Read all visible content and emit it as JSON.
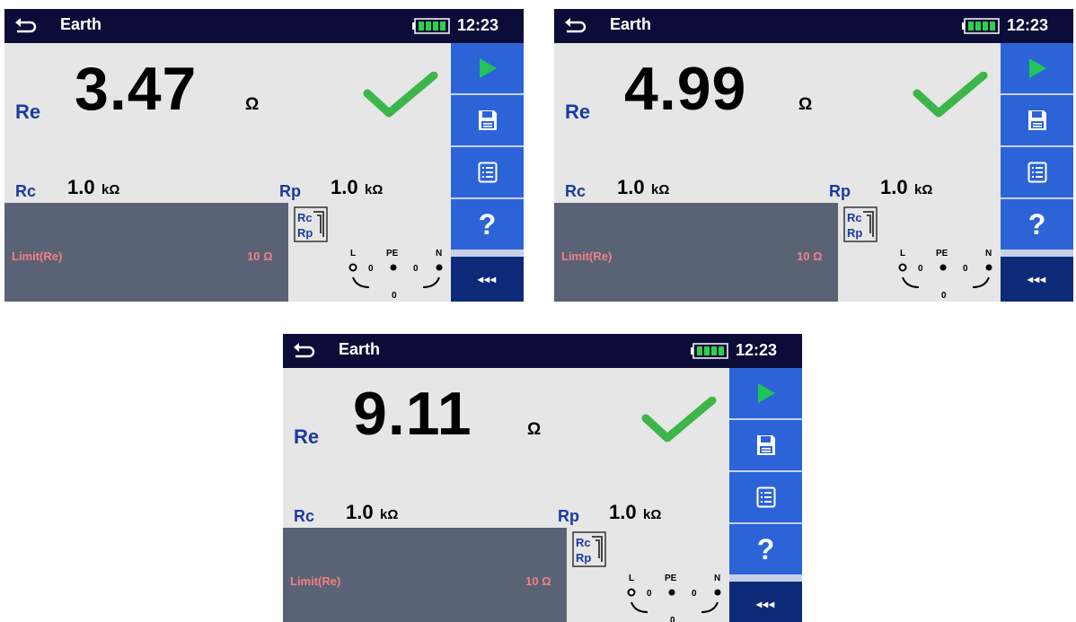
{
  "screens": [
    {
      "title": "Earth",
      "clock": "12:23",
      "re": {
        "label": "Re",
        "value": "3.47",
        "unit": "Ω"
      },
      "rc": {
        "label": "Rc",
        "value": "1.0",
        "unit": "kΩ"
      },
      "rp": {
        "label": "Rp",
        "value": "1.0",
        "unit": "kΩ"
      },
      "limit": {
        "label": "Limit(Re)",
        "value": "10 Ω"
      }
    },
    {
      "title": "Earth",
      "clock": "12:23",
      "re": {
        "label": "Re",
        "value": "4.99",
        "unit": "Ω"
      },
      "rc": {
        "label": "Rc",
        "value": "1.0",
        "unit": "kΩ"
      },
      "rp": {
        "label": "Rp",
        "value": "1.0",
        "unit": "kΩ"
      },
      "limit": {
        "label": "Limit(Re)",
        "value": "10 Ω"
      }
    },
    {
      "title": "Earth",
      "clock": "12:23",
      "re": {
        "label": "Re",
        "value": "9.11",
        "unit": "Ω"
      },
      "rc": {
        "label": "Rc",
        "value": "1.0",
        "unit": "kΩ"
      },
      "rp": {
        "label": "Rp",
        "value": "1.0",
        "unit": "kΩ"
      },
      "limit": {
        "label": "Limit(Re)",
        "value": "10 Ω"
      }
    }
  ],
  "terminals": {
    "l": "L",
    "pe": "PE",
    "n": "N",
    "v1": "0",
    "v2": "0",
    "v3": "0"
  },
  "rcrp_icon_text": {
    "top": "Rc",
    "bottom": "Rp"
  },
  "sidebar": {
    "start_icon": "play-icon",
    "save_icon": "floppy-disk-icon",
    "list_icon": "list-icon",
    "help_label": "?",
    "more_label": "◂◂◂"
  },
  "colors": {
    "titlebar": "#0c0c38",
    "button": "#2c64d8",
    "button_dark": "#0c2a78",
    "pass_check": "#3cb64a",
    "play": "#22c35a",
    "label_blue": "#1a3aa0",
    "limit_panel": "#5a6276",
    "limit_text": "#f28080"
  }
}
